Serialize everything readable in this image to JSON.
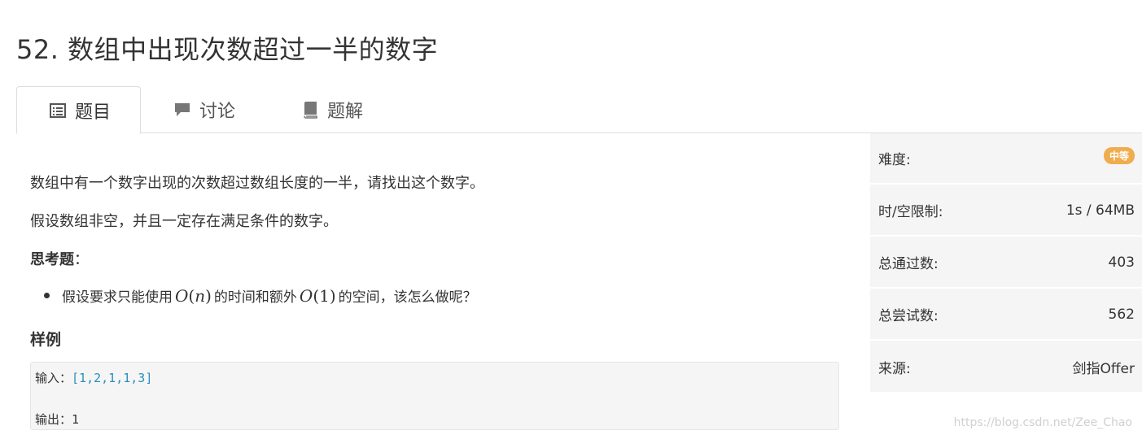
{
  "title": "52. 数组中出现次数超过一半的数字",
  "tabs": [
    {
      "label": "题目",
      "icon": "list-icon",
      "active": true
    },
    {
      "label": "讨论",
      "icon": "comment-icon",
      "active": false
    },
    {
      "label": "题解",
      "icon": "book-icon",
      "active": false
    }
  ],
  "problem": {
    "paragraph1": "数组中有一个数字出现的次数超过数组长度的一半，请找出这个数字。",
    "paragraph2": "假设数组非空，并且一定存在满足条件的数字。",
    "think_label": "思考题",
    "think_colon": "：",
    "bullet_before": "假设要求只能使用",
    "bullet_math1_O": "O",
    "bullet_math1_open": "(",
    "bullet_math1_var": "n",
    "bullet_math1_close": ")",
    "bullet_middle": "的时间和额外",
    "bullet_math2_O": "O",
    "bullet_math2_inner": "(1)",
    "bullet_after": "的空间，该怎么做呢？",
    "example_heading": "样例",
    "example_input_label": "输入：",
    "example_input_value": "[1,2,1,1,3]",
    "example_output_label": "输出：",
    "example_output_value": "1"
  },
  "info": {
    "difficulty_label": "难度:",
    "difficulty_value": "中等",
    "limit_label": "时/空限制:",
    "limit_value": "1s / 64MB",
    "passed_label": "总通过数:",
    "passed_value": "403",
    "attempts_label": "总尝试数:",
    "attempts_value": "562",
    "source_label": "来源:",
    "source_value": "剑指Offer"
  },
  "watermark": "https://blog.csdn.net/Zee_Chao",
  "colors": {
    "badge": "#f0ad4e",
    "panel_bg": "#f5f5f5",
    "code_value": "#2a8fbd"
  }
}
